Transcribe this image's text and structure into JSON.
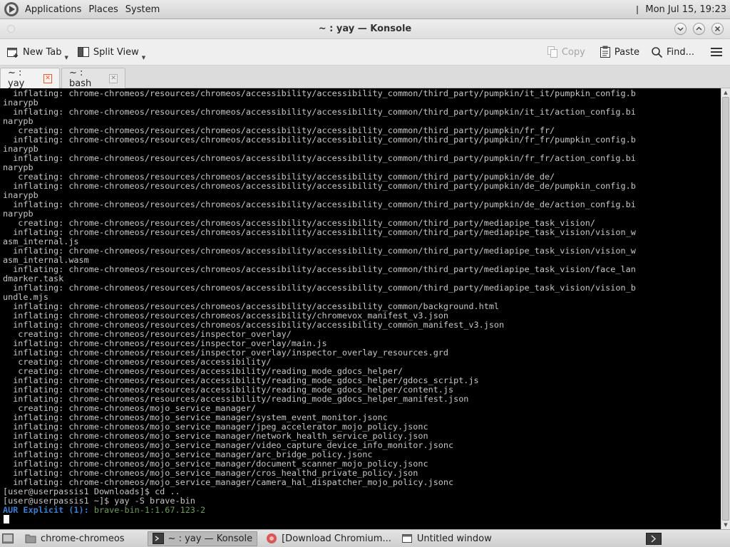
{
  "top_panel": {
    "menus": [
      "Applications",
      "Places",
      "System"
    ],
    "clock": "Mon Jul 15, 19:23"
  },
  "window": {
    "title": "~ : yay — Konsole"
  },
  "toolbar": {
    "new_tab": "New Tab",
    "split_view": "Split View",
    "copy": "Copy",
    "paste": "Paste",
    "find": "Find..."
  },
  "tabs": [
    {
      "label": "~ : yay",
      "active": true
    },
    {
      "label": "~ : bash",
      "active": false
    }
  ],
  "terminal": {
    "lines": [
      "  inflating: chrome-chromeos/resources/chromeos/accessibility/accessibility_common/third_party/pumpkin/it_it/pumpkin_config.b",
      "inarypb",
      "  inflating: chrome-chromeos/resources/chromeos/accessibility/accessibility_common/third_party/pumpkin/it_it/action_config.bi",
      "narypb",
      "   creating: chrome-chromeos/resources/chromeos/accessibility/accessibility_common/third_party/pumpkin/fr_fr/",
      "  inflating: chrome-chromeos/resources/chromeos/accessibility/accessibility_common/third_party/pumpkin/fr_fr/pumpkin_config.b",
      "inarypb",
      "  inflating: chrome-chromeos/resources/chromeos/accessibility/accessibility_common/third_party/pumpkin/fr_fr/action_config.bi",
      "narypb",
      "   creating: chrome-chromeos/resources/chromeos/accessibility/accessibility_common/third_party/pumpkin/de_de/",
      "  inflating: chrome-chromeos/resources/chromeos/accessibility/accessibility_common/third_party/pumpkin/de_de/pumpkin_config.b",
      "inarypb",
      "  inflating: chrome-chromeos/resources/chromeos/accessibility/accessibility_common/third_party/pumpkin/de_de/action_config.bi",
      "narypb",
      "   creating: chrome-chromeos/resources/chromeos/accessibility/accessibility_common/third_party/mediapipe_task_vision/",
      "  inflating: chrome-chromeos/resources/chromeos/accessibility/accessibility_common/third_party/mediapipe_task_vision/vision_w",
      "asm_internal.js",
      "  inflating: chrome-chromeos/resources/chromeos/accessibility/accessibility_common/third_party/mediapipe_task_vision/vision_w",
      "asm_internal.wasm",
      "  inflating: chrome-chromeos/resources/chromeos/accessibility/accessibility_common/third_party/mediapipe_task_vision/face_lan",
      "dmarker.task",
      "  inflating: chrome-chromeos/resources/chromeos/accessibility/accessibility_common/third_party/mediapipe_task_vision/vision_b",
      "undle.mjs",
      "  inflating: chrome-chromeos/resources/chromeos/accessibility/accessibility_common/background.html",
      "  inflating: chrome-chromeos/resources/chromeos/accessibility/chromevox_manifest_v3.json",
      "  inflating: chrome-chromeos/resources/chromeos/accessibility/accessibility_common_manifest_v3.json",
      "   creating: chrome-chromeos/resources/inspector_overlay/",
      "  inflating: chrome-chromeos/resources/inspector_overlay/main.js",
      "  inflating: chrome-chromeos/resources/inspector_overlay/inspector_overlay_resources.grd",
      "   creating: chrome-chromeos/resources/accessibility/",
      "   creating: chrome-chromeos/resources/accessibility/reading_mode_gdocs_helper/",
      "  inflating: chrome-chromeos/resources/accessibility/reading_mode_gdocs_helper/gdocs_script.js",
      "  inflating: chrome-chromeos/resources/accessibility/reading_mode_gdocs_helper/content.js",
      "  inflating: chrome-chromeos/resources/accessibility/reading_mode_gdocs_helper_manifest.json",
      "   creating: chrome-chromeos/mojo_service_manager/",
      "  inflating: chrome-chromeos/mojo_service_manager/system_event_monitor.jsonc",
      "  inflating: chrome-chromeos/mojo_service_manager/jpeg_accelerator_mojo_policy.jsonc",
      "  inflating: chrome-chromeos/mojo_service_manager/network_health_service_policy.json",
      "  inflating: chrome-chromeos/mojo_service_manager/video_capture_device_info_monitor.jsonc",
      "  inflating: chrome-chromeos/mojo_service_manager/arc_bridge_policy.jsonc",
      "  inflating: chrome-chromeos/mojo_service_manager/document_scanner_mojo_policy.jsonc",
      "  inflating: chrome-chromeos/mojo_service_manager/cros_healthd_private_policy.json",
      "  inflating: chrome-chromeos/mojo_service_manager/camera_hal_dispatcher_mojo_policy.jsonc",
      "[user@userpassis1 Downloads]$ cd ..",
      "[user@userpassis1 ~]$ yay -S brave-bin"
    ],
    "aur_label": "AUR Explicit (1):",
    "aur_package": " brave-bin-1:1.67.123-2"
  },
  "taskbar": {
    "items": [
      {
        "label": "chrome-chromeos",
        "icon": "folder-icon"
      },
      {
        "label": "~ : yay — Konsole",
        "icon": "terminal-icon"
      },
      {
        "label": "[Download Chromium...",
        "icon": "browser-icon"
      },
      {
        "label": "Untitled window",
        "icon": "window-icon"
      }
    ]
  },
  "colors": {
    "terminal_bg": "#000000",
    "terminal_fg": "#c6c6c6",
    "aur_blue": "#3a7ccd",
    "aur_green": "#6f9d56",
    "tab_close_active": "#e25b34"
  }
}
